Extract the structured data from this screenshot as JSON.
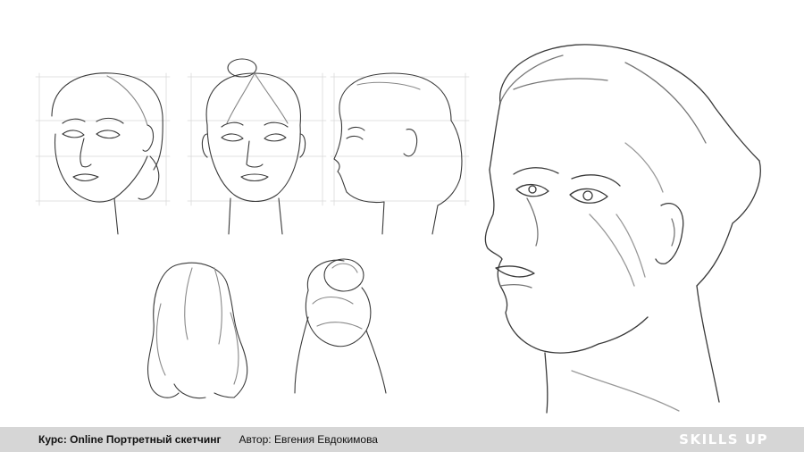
{
  "footer": {
    "course": "Курс: Online Портретный скетчинг",
    "author": "Автор: Евгения Евдокимова",
    "brand": "SKILLS UP"
  },
  "colors": {
    "footer_bg": "#d6d6d6",
    "stroke": "#3a3a3a",
    "guide": "#d9d9d9"
  },
  "drawings": [
    "head-three-quarter-view-sketch",
    "head-front-view-sketch",
    "head-profile-view-sketch",
    "long-wavy-hair-sketch",
    "hair-bun-back-view-sketch",
    "large-head-portrait-sketch"
  ]
}
